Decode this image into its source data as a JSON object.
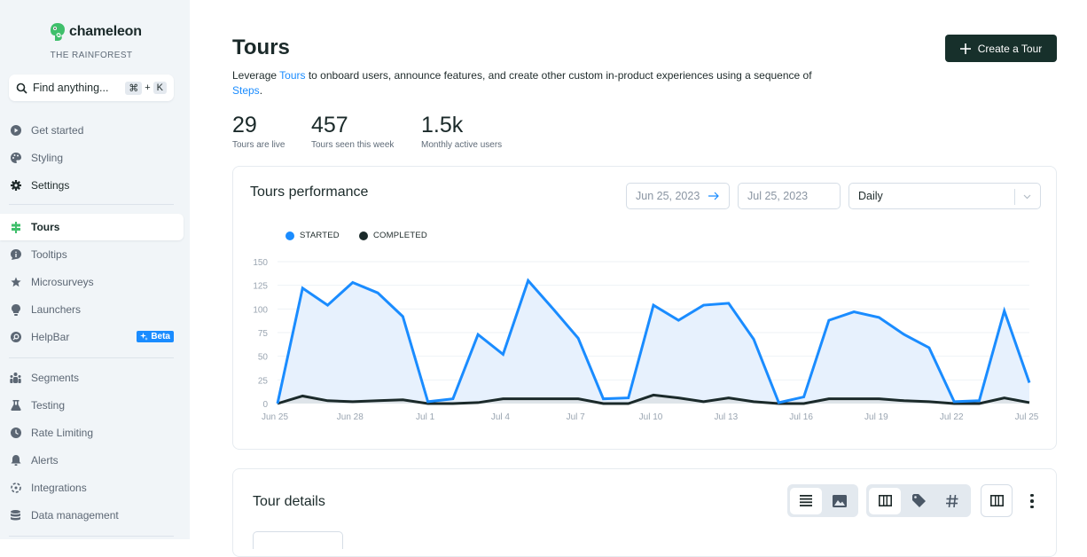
{
  "brand": {
    "name": "chameleon",
    "org": "THE RAINFOREST",
    "color": "#3fbf6b"
  },
  "search": {
    "placeholder": "Find anything...",
    "shortcut_mod": "⌘",
    "shortcut_plus": "+",
    "shortcut_key": "K"
  },
  "sidebar": {
    "items": [
      {
        "label": "Get started",
        "icon": "play-circle-icon"
      },
      {
        "label": "Styling",
        "icon": "palette-icon"
      },
      {
        "label": "Settings",
        "icon": "gear-icon"
      },
      {
        "label": "Tours",
        "icon": "signpost-icon",
        "active": true
      },
      {
        "label": "Tooltips",
        "icon": "info-bubble-icon"
      },
      {
        "label": "Microsurveys",
        "icon": "star-icon"
      },
      {
        "label": "Launchers",
        "icon": "lightbulb-icon"
      },
      {
        "label": "HelpBar",
        "icon": "helpbar-icon",
        "badge": "Beta"
      },
      {
        "label": "Segments",
        "icon": "users-icon"
      },
      {
        "label": "Testing",
        "icon": "flask-icon"
      },
      {
        "label": "Rate Limiting",
        "icon": "clock-icon"
      },
      {
        "label": "Alerts",
        "icon": "bell-icon"
      },
      {
        "label": "Integrations",
        "icon": "integrations-icon"
      },
      {
        "label": "Data management",
        "icon": "database-icon"
      }
    ]
  },
  "header": {
    "title": "Tours",
    "create_button": "Create a Tour",
    "desc_before": "Leverage ",
    "desc_link1": "Tours",
    "desc_middle": " to onboard users, announce features, and create other custom in-product experiences using a sequence of ",
    "desc_link2": "Steps",
    "desc_after": "."
  },
  "stats": [
    {
      "value": "29",
      "label": "Tours are live"
    },
    {
      "value": "457",
      "label": "Tours seen this week"
    },
    {
      "value": "1.5k",
      "label": "Monthly active users"
    }
  ],
  "performance": {
    "title": "Tours performance",
    "start_date": "Jun 25, 2023",
    "end_date": "Jul 25, 2023",
    "interval": "Daily"
  },
  "details": {
    "title": "Tour details"
  },
  "colors": {
    "started": "#1a8cff",
    "completed": "#1b2a2a",
    "accent": "#1a8cff",
    "button_dark": "#17302b"
  },
  "chart_data": {
    "type": "area",
    "title": "Tours performance",
    "xlabel": "",
    "ylabel": "",
    "ylim": [
      0,
      150
    ],
    "yticks": [
      0,
      25,
      50,
      75,
      100,
      125,
      150
    ],
    "grid": true,
    "legend": "top-left",
    "x": [
      "Jun 25",
      "Jun 26",
      "Jun 27",
      "Jun 28",
      "Jun 29",
      "Jun 30",
      "Jul 1",
      "Jul 2",
      "Jul 3",
      "Jul 4",
      "Jul 5",
      "Jul 6",
      "Jul 7",
      "Jul 8",
      "Jul 9",
      "Jul 10",
      "Jul 11",
      "Jul 12",
      "Jul 13",
      "Jul 14",
      "Jul 15",
      "Jul 16",
      "Jul 17",
      "Jul 18",
      "Jul 19",
      "Jul 20",
      "Jul 21",
      "Jul 22",
      "Jul 23",
      "Jul 24",
      "Jul 25"
    ],
    "xtick_labels": [
      "Jun 25",
      "Jun 28",
      "Jul 1",
      "Jul 4",
      "Jul 7",
      "Jul 10",
      "Jul 13",
      "Jul 16",
      "Jul 19",
      "Jul 22",
      "Jul 25"
    ],
    "series": [
      {
        "name": "STARTED",
        "values": [
          0,
          122,
          104,
          128,
          117,
          92,
          2,
          5,
          73,
          52,
          130,
          100,
          69,
          5,
          6,
          104,
          88,
          104,
          106,
          68,
          1,
          7,
          88,
          97,
          91,
          73,
          59,
          2,
          3,
          98,
          22
        ]
      },
      {
        "name": "COMPLETED",
        "values": [
          0,
          8,
          3,
          2,
          3,
          4,
          0,
          0,
          1,
          5,
          5,
          5,
          5,
          0,
          0,
          9,
          6,
          2,
          6,
          2,
          0,
          0,
          5,
          5,
          5,
          3,
          2,
          0,
          0,
          6,
          1
        ]
      }
    ]
  }
}
